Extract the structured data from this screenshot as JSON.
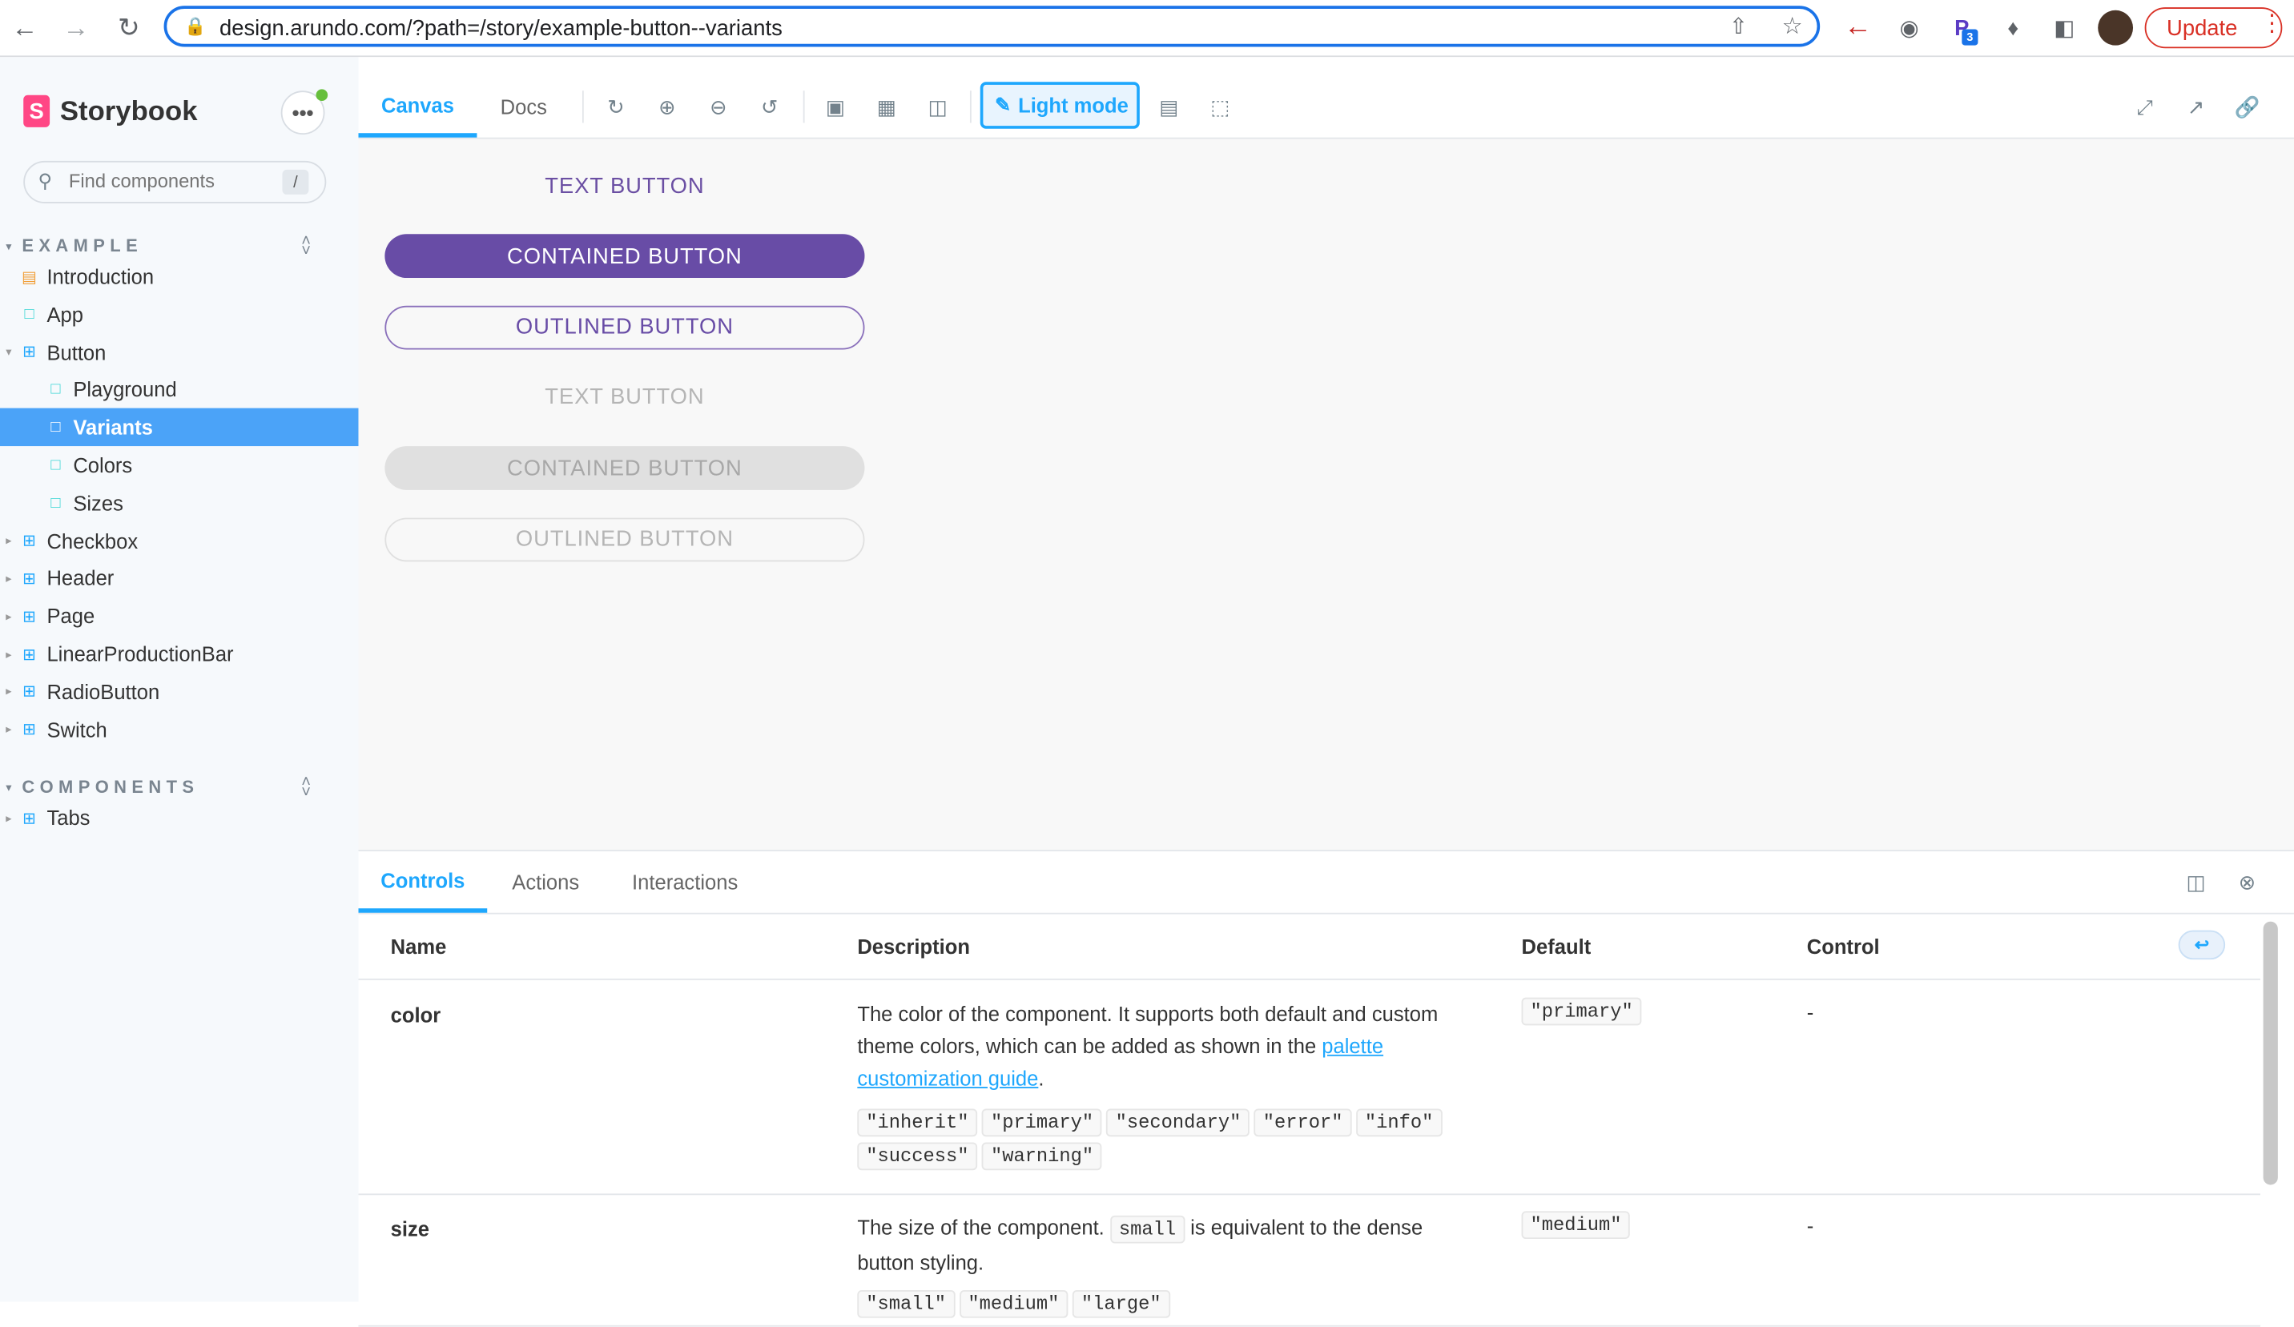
{
  "browser": {
    "url": "design.arundo.com/?path=/story/example-button--variants",
    "update_label": "Update",
    "ext_badge": "3"
  },
  "sidebar": {
    "brand": "Storybook",
    "brand_letter": "S",
    "search_placeholder": "Find components",
    "search_shortcut": "/",
    "sections": [
      {
        "title": "EXAMPLE",
        "items": [
          {
            "label": "Introduction",
            "kind": "doc"
          },
          {
            "label": "App",
            "kind": "story"
          },
          {
            "label": "Button",
            "kind": "component"
          },
          {
            "label": "Playground",
            "kind": "story"
          },
          {
            "label": "Variants",
            "kind": "story",
            "selected": true
          },
          {
            "label": "Colors",
            "kind": "story"
          },
          {
            "label": "Sizes",
            "kind": "story"
          },
          {
            "label": "Checkbox",
            "kind": "component"
          },
          {
            "label": "Header",
            "kind": "component"
          },
          {
            "label": "Page",
            "kind": "component"
          },
          {
            "label": "LinearProductionBar",
            "kind": "component"
          },
          {
            "label": "RadioButton",
            "kind": "component"
          },
          {
            "label": "Switch",
            "kind": "component"
          }
        ]
      },
      {
        "title": "COMPONENTS",
        "items": [
          {
            "label": "Tabs",
            "kind": "component"
          }
        ]
      }
    ]
  },
  "toolbar": {
    "tabs": [
      "Canvas",
      "Docs"
    ],
    "light_mode_label": "Light mode"
  },
  "canvas": {
    "buttons": [
      {
        "label": "TEXT BUTTON",
        "variant": "text",
        "disabled": false
      },
      {
        "label": "CONTAINED BUTTON",
        "variant": "contained",
        "disabled": false
      },
      {
        "label": "OUTLINED BUTTON",
        "variant": "outlined",
        "disabled": false
      },
      {
        "label": "TEXT BUTTON",
        "variant": "text",
        "disabled": true
      },
      {
        "label": "CONTAINED BUTTON",
        "variant": "contained",
        "disabled": true
      },
      {
        "label": "OUTLINED BUTTON",
        "variant": "outlined",
        "disabled": true
      }
    ]
  },
  "addons": {
    "tabs": [
      "Controls",
      "Actions",
      "Interactions"
    ],
    "columns": [
      "Name",
      "Description",
      "Default",
      "Control"
    ],
    "rows": [
      {
        "name": "color",
        "desc_before": "The color of the component. It supports both default and custom theme colors, which can be added as shown in the ",
        "desc_link": "palette customization guide",
        "desc_after": ".",
        "default": "\"primary\"",
        "control": "-",
        "options": [
          "\"inherit\"",
          "\"primary\"",
          "\"secondary\"",
          "\"error\"",
          "\"info\"",
          "\"success\"",
          "\"warning\""
        ]
      },
      {
        "name": "size",
        "desc_before": "The size of the component. ",
        "desc_code": "small",
        "desc_after": " is equivalent to the dense button styling.",
        "default": "\"medium\"",
        "control": "-",
        "options": [
          "\"small\"",
          "\"medium\"",
          "\"large\""
        ]
      }
    ]
  },
  "colors": {
    "accent": "#1ea7fd",
    "selected": "#4ba3f8",
    "mui_primary": "#684ca6",
    "storybook_pink": "#ff4785"
  }
}
